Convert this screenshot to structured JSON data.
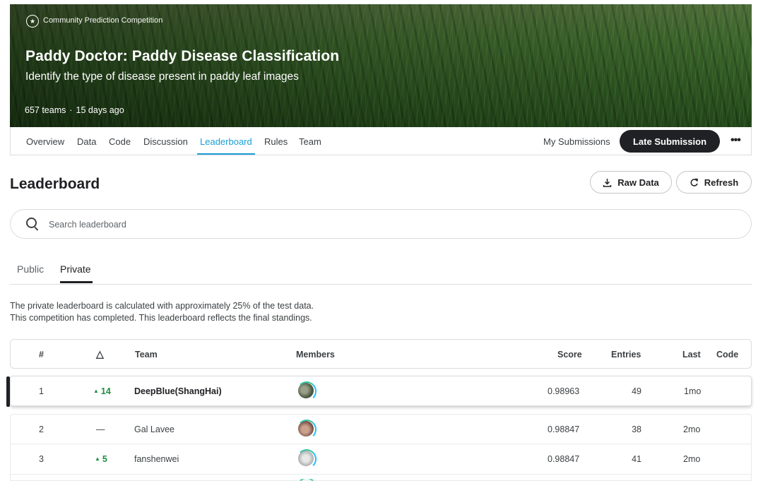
{
  "competition": {
    "badge": "Community Prediction Competition",
    "title": "Paddy Doctor: Paddy Disease Classification",
    "subtitle": "Identify the type of disease present in paddy leaf images",
    "teams": "657 teams",
    "separator": "·",
    "time": "15 days ago"
  },
  "nav": {
    "tabs": [
      "Overview",
      "Data",
      "Code",
      "Discussion",
      "Leaderboard",
      "Rules",
      "Team"
    ],
    "active_tab": "Leaderboard",
    "my_submissions": "My Submissions",
    "late_submission": "Late Submission",
    "more": "•••"
  },
  "leaderboard": {
    "title": "Leaderboard",
    "raw_data": "Raw Data",
    "refresh": "Refresh",
    "search_placeholder": "Search leaderboard",
    "tabs": [
      "Public",
      "Private"
    ],
    "active_tab": "Private",
    "desc_line1": "The private leaderboard is calculated with approximately 25% of the test data.",
    "desc_line2": "This competition has completed. This leaderboard reflects the final standings.",
    "columns": {
      "rank": "#",
      "delta": "△",
      "team": "Team",
      "members": "Members",
      "score": "Score",
      "entries": "Entries",
      "last": "Last",
      "code": "Code"
    },
    "rows": [
      {
        "rank": "1",
        "delta": "14",
        "delta_dir": "up",
        "team": "DeepBlue(ShangHai)",
        "score": "0.98963",
        "entries": "49",
        "last": "1mo"
      },
      {
        "rank": "2",
        "delta": "—",
        "delta_dir": "none",
        "team": "Gal Lavee",
        "score": "0.98847",
        "entries": "38",
        "last": "2mo"
      },
      {
        "rank": "3",
        "delta": "5",
        "delta_dir": "up",
        "team": "fanshenwei",
        "score": "0.98847",
        "entries": "41",
        "last": "2mo"
      }
    ]
  },
  "colors": {
    "accent": "#1b9ed6",
    "up": "#1e8e3e",
    "dark_button": "#202124"
  }
}
